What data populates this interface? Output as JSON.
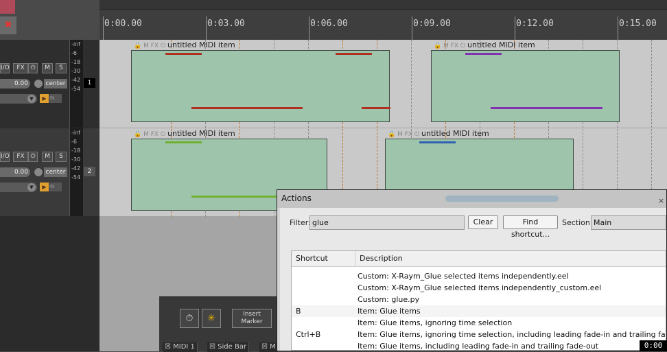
{
  "ruler": {
    "labels": [
      "0:00.00",
      "0:03.00",
      "0:06.00",
      "0:09.00",
      "0:12.00",
      "0:15.00"
    ]
  },
  "tracks": [
    {
      "number": "1",
      "io_label": "I/O",
      "fx_label": "FX",
      "mute": "M",
      "solo": "S",
      "volume": "0.00",
      "pan": "center",
      "in_label": "IN",
      "meter": [
        "-inf",
        "-6",
        "-18",
        "-30",
        "-42",
        "-54"
      ]
    },
    {
      "number": "2",
      "io_label": "I/O",
      "fx_label": "FX",
      "mute": "M",
      "solo": "S",
      "volume": "0.00",
      "pan": "center",
      "in_label": "IN",
      "meter": [
        "-inf",
        "-6",
        "-18",
        "-30",
        "-42",
        "-54"
      ]
    }
  ],
  "items": [
    {
      "icons": "🔒 M FX ⏻",
      "name": "untitled MIDI item"
    },
    {
      "icons": "🔒 M FX ⏻",
      "name": "untitled MIDI item"
    },
    {
      "icons": "🔒 M FX ⏻",
      "name": "untitled MIDI item"
    },
    {
      "icons": "🔒 M FX ⏻",
      "name": "untitled MIDI item"
    }
  ],
  "colors": {
    "item_bg": "#9ec4ac",
    "note_red": "#b03020",
    "note_purple": "#8030b0",
    "note_green": "#70b030",
    "note_blue": "#3060b0",
    "grid_orange": "#c07830"
  },
  "dock": {
    "insert_marker": "Insert Marker",
    "tabs": [
      "MIDI 1",
      "Side Bar",
      "M"
    ]
  },
  "dialog": {
    "title": "Actions",
    "close": "×",
    "filter_label": "Filter:",
    "filter_value": "glue",
    "clear_button": "Clear",
    "find_shortcut_button": "Find shortcut...",
    "section_label": "Section:",
    "section_value": "Main",
    "columns": {
      "shortcut": "Shortcut",
      "description": "Description"
    },
    "rows": [
      {
        "shortcut": "",
        "description": "Custom: X-Raym_Glue selected items independently.eel"
      },
      {
        "shortcut": "",
        "description": "Custom: X-Raym_Glue selected items independently_custom.eel"
      },
      {
        "shortcut": "",
        "description": "Custom: glue.py"
      },
      {
        "shortcut": "B",
        "description": "Item: Glue items"
      },
      {
        "shortcut": "",
        "description": "Item: Glue items, ignoring time selection"
      },
      {
        "shortcut": "Ctrl+B",
        "description": "Item: Glue items, ignoring time selection, including leading fade-in and trailing fade-out"
      },
      {
        "shortcut": "",
        "description": "Item: Glue items, including leading fade-in and trailing fade-out"
      }
    ]
  },
  "time_badge": "0:00"
}
